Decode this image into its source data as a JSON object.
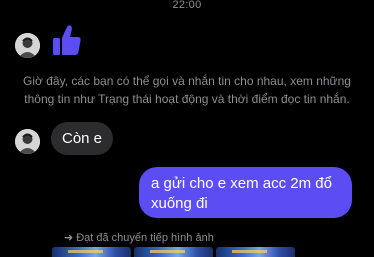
{
  "header": {
    "timestamp": "22:00"
  },
  "messages": {
    "incoming_like": {
      "sender_avatar": "avatar-icon",
      "icon": "thumbs-up-icon"
    },
    "system_notice": "Giờ đây, các bạn có thể gọi và nhắn tin cho nhau, xem những thông tin như Trạng thái hoạt động và thời điểm đọc tin nhắn.",
    "incoming_text": {
      "sender_avatar": "avatar-icon",
      "text": "Còn e"
    },
    "outgoing_text": {
      "text": "a gửi cho e xem acc 2m đổ xuống đi"
    },
    "forward_note": {
      "icon": "forward-arrow-icon",
      "text": "Đạt đã chuyển tiếp hình ảnh"
    }
  },
  "colors": {
    "background": "#000000",
    "outgoing_bubble": "#5b4cf4",
    "incoming_bubble": "#2c2c2e",
    "like_icon": "#5b4cf4",
    "muted_text": "#8e8e93"
  }
}
